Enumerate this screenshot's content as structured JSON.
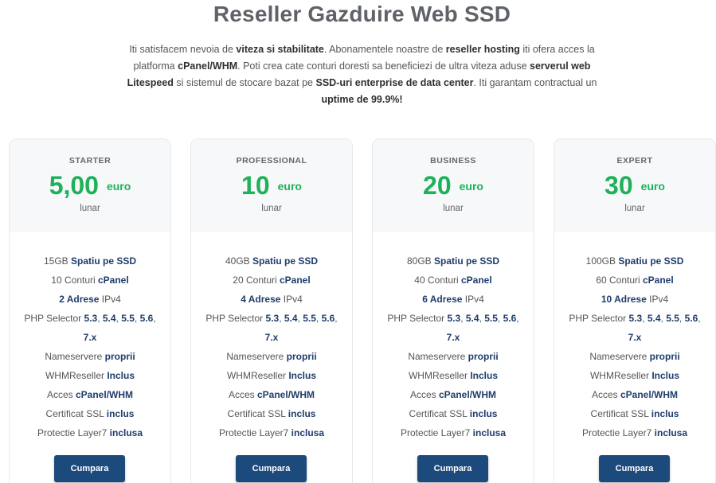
{
  "title": "Reseller Gazduire Web SSD",
  "intro": [
    {
      "t": "Iti satisfacem nevoia de ",
      "b": false
    },
    {
      "t": "viteza si stabilitate",
      "b": true
    },
    {
      "t": ". Abonamentele noastre de ",
      "b": false
    },
    {
      "t": "reseller hosting",
      "b": true
    },
    {
      "t": " iti ofera acces la platforma ",
      "b": false
    },
    {
      "t": "cPanel/WHM",
      "b": true
    },
    {
      "t": ". Poti crea cate conturi doresti sa beneficiezi de ultra viteza aduse ",
      "b": false
    },
    {
      "t": "serverul web Litespeed",
      "b": true
    },
    {
      "t": " si sistemul de stocare bazat pe ",
      "b": false
    },
    {
      "t": "SSD-uri enterprise de data center",
      "b": true
    },
    {
      "t": ". Iti garantam contractual un ",
      "b": false
    },
    {
      "t": "uptime de 99.9%!",
      "b": true
    }
  ],
  "plans": [
    {
      "name": "STARTER",
      "price": "5,00",
      "currency": "euro",
      "period": "lunar",
      "features": [
        [
          [
            "15GB ",
            false
          ],
          [
            "Spatiu pe SSD",
            true
          ]
        ],
        [
          [
            "10 Conturi ",
            false
          ],
          [
            "cPanel",
            true
          ]
        ],
        [
          [
            "2 Adrese ",
            true
          ],
          [
            "IPv4",
            false
          ]
        ],
        [
          [
            "PHP Selector ",
            false
          ],
          [
            "5.3",
            true
          ],
          [
            ", ",
            false
          ],
          [
            "5.4",
            true
          ],
          [
            ", ",
            false
          ],
          [
            "5.5",
            true
          ],
          [
            ", ",
            false
          ],
          [
            "5.6",
            true
          ],
          [
            ", ",
            false
          ],
          [
            "7.x",
            true
          ]
        ],
        [
          [
            "Nameservere ",
            false
          ],
          [
            "proprii",
            true
          ]
        ],
        [
          [
            "WHMReseller ",
            false
          ],
          [
            "Inclus",
            true
          ]
        ],
        [
          [
            "Acces ",
            false
          ],
          [
            "cPanel/WHM",
            true
          ]
        ],
        [
          [
            "Certificat SSL ",
            false
          ],
          [
            "inclus",
            true
          ]
        ],
        [
          [
            "Protectie Layer7 ",
            false
          ],
          [
            "inclusa",
            true
          ]
        ]
      ],
      "button": "Cumpara"
    },
    {
      "name": "PROFESSIONAL",
      "price": "10",
      "currency": "euro",
      "period": "lunar",
      "features": [
        [
          [
            "40GB ",
            false
          ],
          [
            "Spatiu pe SSD",
            true
          ]
        ],
        [
          [
            "20 Conturi ",
            false
          ],
          [
            "cPanel",
            true
          ]
        ],
        [
          [
            "4 Adrese ",
            true
          ],
          [
            "IPv4",
            false
          ]
        ],
        [
          [
            "PHP Selector ",
            false
          ],
          [
            "5.3",
            true
          ],
          [
            ", ",
            false
          ],
          [
            "5.4",
            true
          ],
          [
            ", ",
            false
          ],
          [
            "5.5",
            true
          ],
          [
            ", ",
            false
          ],
          [
            "5.6",
            true
          ],
          [
            ", ",
            false
          ],
          [
            "7.x",
            true
          ]
        ],
        [
          [
            "Nameservere ",
            false
          ],
          [
            "proprii",
            true
          ]
        ],
        [
          [
            "WHMReseller ",
            false
          ],
          [
            "Inclus",
            true
          ]
        ],
        [
          [
            "Acces ",
            false
          ],
          [
            "cPanel/WHM",
            true
          ]
        ],
        [
          [
            "Certificat SSL ",
            false
          ],
          [
            "inclus",
            true
          ]
        ],
        [
          [
            "Protectie Layer7 ",
            false
          ],
          [
            "inclusa",
            true
          ]
        ]
      ],
      "button": "Cumpara"
    },
    {
      "name": "BUSINESS",
      "price": "20",
      "currency": "euro",
      "period": "lunar",
      "features": [
        [
          [
            "80GB ",
            false
          ],
          [
            "Spatiu pe SSD",
            true
          ]
        ],
        [
          [
            "40 Conturi ",
            false
          ],
          [
            "cPanel",
            true
          ]
        ],
        [
          [
            "6 Adrese ",
            true
          ],
          [
            "IPv4",
            false
          ]
        ],
        [
          [
            "PHP Selector ",
            false
          ],
          [
            "5.3",
            true
          ],
          [
            ", ",
            false
          ],
          [
            "5.4",
            true
          ],
          [
            ", ",
            false
          ],
          [
            "5.5",
            true
          ],
          [
            ", ",
            false
          ],
          [
            "5.6",
            true
          ],
          [
            ", ",
            false
          ],
          [
            "7.x",
            true
          ]
        ],
        [
          [
            "Nameservere ",
            false
          ],
          [
            "proprii",
            true
          ]
        ],
        [
          [
            "WHMReseller ",
            false
          ],
          [
            "Inclus",
            true
          ]
        ],
        [
          [
            "Acces ",
            false
          ],
          [
            "cPanel/WHM",
            true
          ]
        ],
        [
          [
            "Certificat SSL ",
            false
          ],
          [
            "inclus",
            true
          ]
        ],
        [
          [
            "Protectie Layer7 ",
            false
          ],
          [
            "inclusa",
            true
          ]
        ]
      ],
      "button": "Cumpara"
    },
    {
      "name": "EXPERT",
      "price": "30",
      "currency": "euro",
      "period": "lunar",
      "features": [
        [
          [
            "100GB ",
            false
          ],
          [
            "Spatiu pe SSD",
            true
          ]
        ],
        [
          [
            "60 Conturi ",
            false
          ],
          [
            "cPanel",
            true
          ]
        ],
        [
          [
            "10 Adrese ",
            true
          ],
          [
            "IPv4",
            false
          ]
        ],
        [
          [
            "PHP Selector ",
            false
          ],
          [
            "5.3",
            true
          ],
          [
            ", ",
            false
          ],
          [
            "5.4",
            true
          ],
          [
            ", ",
            false
          ],
          [
            "5.5",
            true
          ],
          [
            ", ",
            false
          ],
          [
            "5.6",
            true
          ],
          [
            ", ",
            false
          ],
          [
            "7.x",
            true
          ]
        ],
        [
          [
            "Nameservere ",
            false
          ],
          [
            "proprii",
            true
          ]
        ],
        [
          [
            "WHMReseller ",
            false
          ],
          [
            "Inclus",
            true
          ]
        ],
        [
          [
            "Acces ",
            false
          ],
          [
            "cPanel/WHM",
            true
          ]
        ],
        [
          [
            "Certificat SSL ",
            false
          ],
          [
            "inclus",
            true
          ]
        ],
        [
          [
            "Protectie Layer7 ",
            false
          ],
          [
            "inclusa",
            true
          ]
        ]
      ],
      "button": "Cumpara"
    }
  ],
  "colors": {
    "price_green": "#1fb15a",
    "button_blue": "#1d4a7c",
    "feature_bold": "#1e3d6b"
  }
}
